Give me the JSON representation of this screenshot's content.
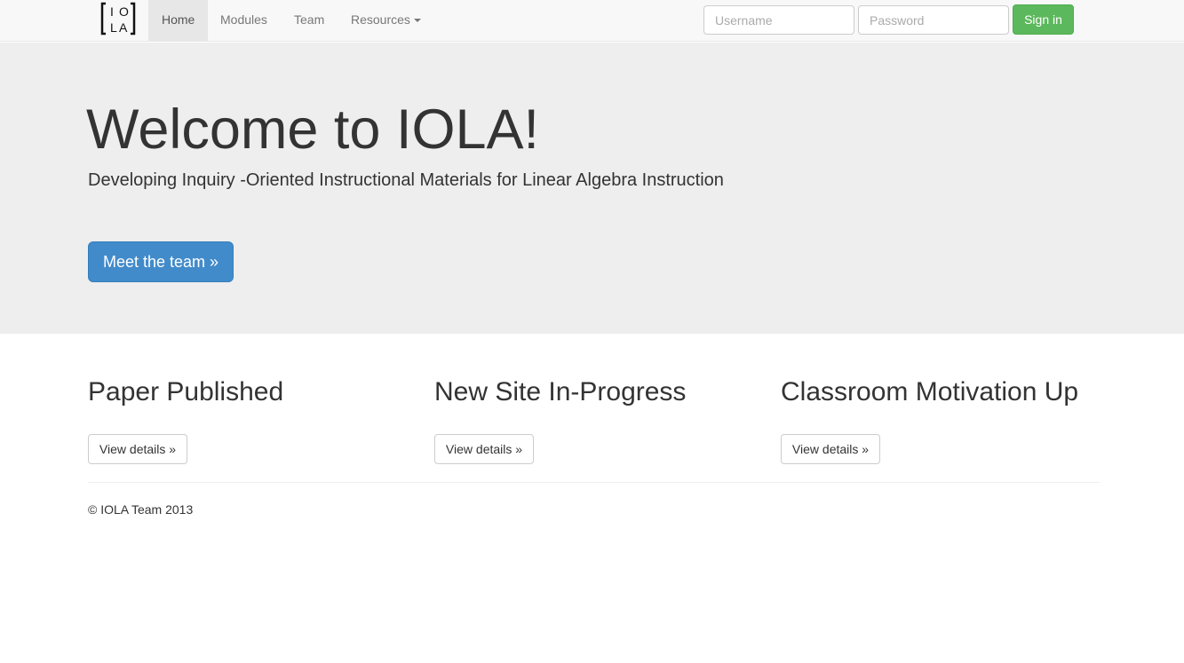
{
  "brand": {
    "logo_letters": [
      "I",
      "O",
      "L",
      "A"
    ]
  },
  "nav": {
    "items": [
      {
        "label": "Home",
        "active": true
      },
      {
        "label": "Modules",
        "active": false
      },
      {
        "label": "Team",
        "active": false
      },
      {
        "label": "Resources",
        "active": false,
        "dropdown": true
      }
    ]
  },
  "login": {
    "username_placeholder": "Username",
    "username_value": "",
    "password_placeholder": "Password",
    "password_value": "",
    "signin_label": "Sign in"
  },
  "jumbotron": {
    "title": "Welcome to IOLA!",
    "subtitle": "Developing Inquiry -Oriented Instructional Materials for Linear Algebra Instruction",
    "button_label": "Meet the team »"
  },
  "columns": [
    {
      "heading": "Paper Published",
      "button_label": "View details »"
    },
    {
      "heading": "New Site In-Progress",
      "button_label": "View details »"
    },
    {
      "heading": "Classroom Motivation Up",
      "button_label": "View details »"
    }
  ],
  "footer": {
    "text": "© IOLA Team 2013"
  },
  "colors": {
    "navbar_bg": "#f8f8f8",
    "jumbotron_bg": "#eeeeee",
    "primary": "#428bca",
    "success": "#5cb85c"
  }
}
